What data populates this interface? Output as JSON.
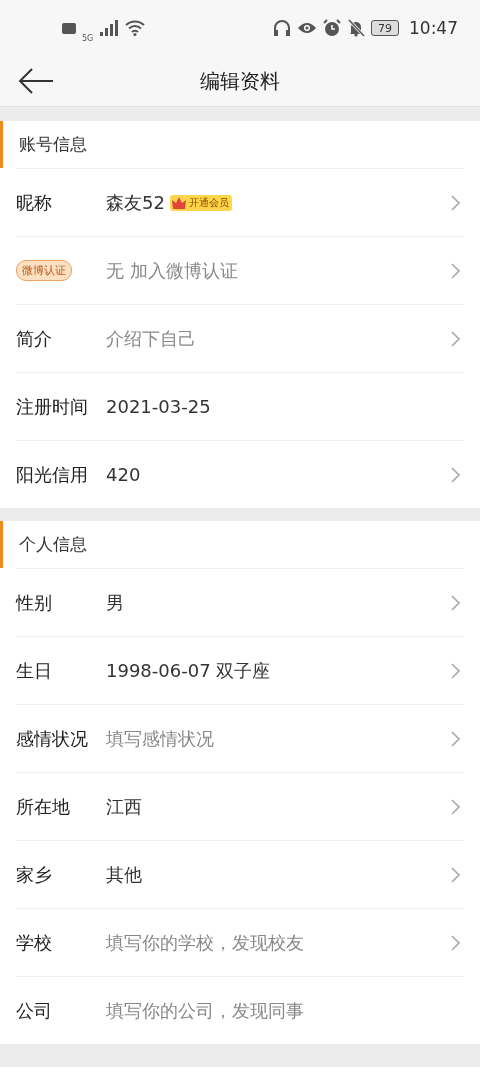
{
  "status_bar": {
    "network": "5G",
    "battery": "79",
    "time": "10:47"
  },
  "header": {
    "title": "编辑资料"
  },
  "sections": [
    {
      "title": "账号信息",
      "rows": [
        {
          "label": "昵称",
          "kind": "text",
          "value": "森友52",
          "muted": false,
          "tag": "开通会员",
          "arrow": true
        },
        {
          "label": "微博认证",
          "kind": "badge",
          "value": "无 加入微博认证",
          "muted": true,
          "arrow": true
        },
        {
          "label": "简介",
          "kind": "text",
          "value": "介绍下自己",
          "muted": true,
          "arrow": true
        },
        {
          "label": "注册时间",
          "kind": "text",
          "value": "2021-03-25",
          "muted": false,
          "arrow": false
        },
        {
          "label": "阳光信用",
          "kind": "text",
          "value": "420",
          "muted": false,
          "arrow": true
        }
      ]
    },
    {
      "title": "个人信息",
      "rows": [
        {
          "label": "性别",
          "kind": "text",
          "value": "男",
          "muted": false,
          "arrow": true
        },
        {
          "label": "生日",
          "kind": "text",
          "value": "1998-06-07 双子座",
          "muted": false,
          "arrow": true
        },
        {
          "label": "感情状况",
          "kind": "text",
          "value": "填写感情状况",
          "muted": true,
          "arrow": true
        },
        {
          "label": "所在地",
          "kind": "text",
          "value": "江西",
          "muted": false,
          "arrow": true
        },
        {
          "label": "家乡",
          "kind": "text",
          "value": "其他",
          "muted": false,
          "arrow": true
        },
        {
          "label": "学校",
          "kind": "text",
          "value": "填写你的学校，发现校友",
          "muted": true,
          "arrow": true
        },
        {
          "label": "公司",
          "kind": "text",
          "value": "填写你的公司，发现同事",
          "muted": true,
          "arrow": false
        }
      ]
    }
  ]
}
